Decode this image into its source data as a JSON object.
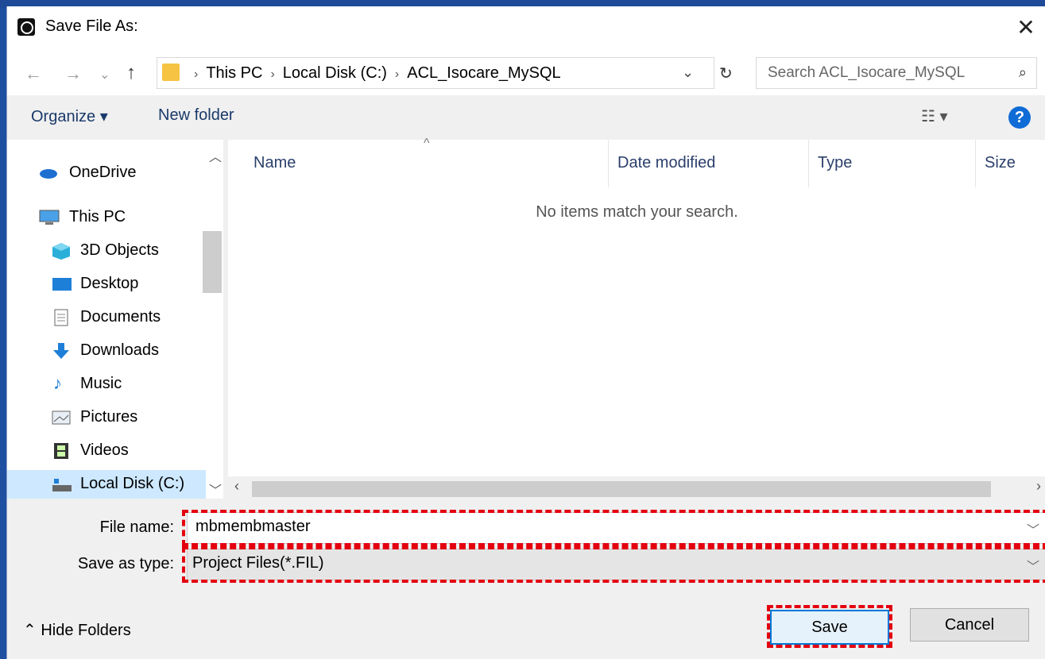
{
  "window": {
    "title": "Save File As:"
  },
  "nav": {
    "back": "←",
    "forward": "→",
    "recent": "⌄",
    "up": "↑",
    "breadcrumb": [
      "This PC",
      "Local Disk (C:)",
      "ACL_Isocare_MySQL"
    ],
    "search_placeholder": "Search ACL_Isocare_MySQL"
  },
  "toolbar": {
    "organize": "Organize ▾",
    "new_folder": "New folder"
  },
  "sidebar": {
    "items": [
      {
        "label": "OneDrive",
        "icon": "cloud-icon"
      },
      {
        "label": "This PC",
        "icon": "computer-icon"
      },
      {
        "label": "3D Objects",
        "icon": "cube-icon"
      },
      {
        "label": "Desktop",
        "icon": "desktop-icon"
      },
      {
        "label": "Documents",
        "icon": "document-icon"
      },
      {
        "label": "Downloads",
        "icon": "download-icon"
      },
      {
        "label": "Music",
        "icon": "music-icon"
      },
      {
        "label": "Pictures",
        "icon": "picture-icon"
      },
      {
        "label": "Videos",
        "icon": "film-icon"
      },
      {
        "label": "Local Disk (C:)",
        "icon": "drive-icon"
      }
    ]
  },
  "file_list": {
    "columns": [
      "Name",
      "Date modified",
      "Type",
      "Size"
    ],
    "empty_message": "No items match your search."
  },
  "form": {
    "file_name_label": "File name:",
    "file_name_value": "mbmembmaster",
    "save_type_label": "Save as type:",
    "save_type_value": "Project Files(*.FIL)"
  },
  "footer": {
    "hide_folders": "Hide Folders",
    "save": "Save",
    "cancel": "Cancel"
  },
  "colors": {
    "highlight_border": "#e3000f",
    "selected_item": "#cde8ff",
    "accent": "#0078d7"
  }
}
